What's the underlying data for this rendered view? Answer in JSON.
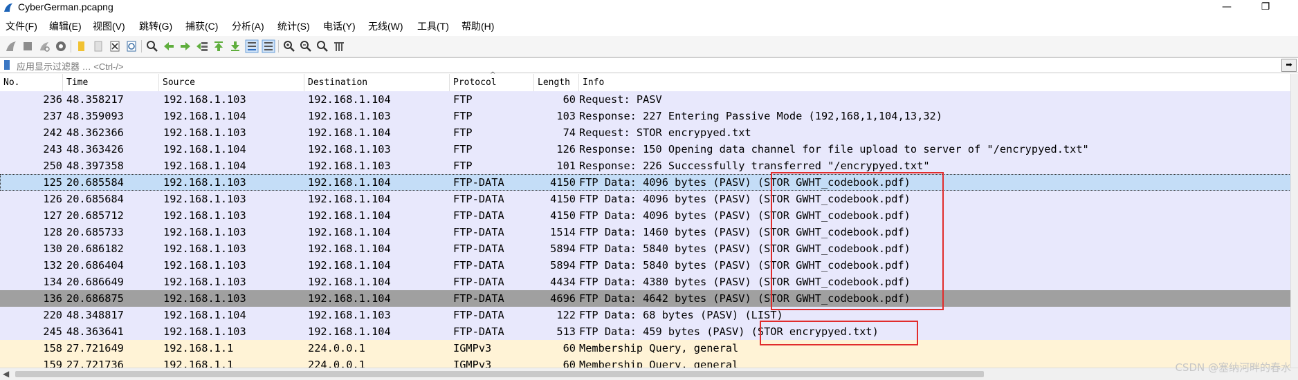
{
  "window": {
    "title": "CyberGerman.pcapng",
    "minimize": "—",
    "maximize": "❐"
  },
  "menu": [
    "文件(F)",
    "编辑(E)",
    "视图(V)",
    "跳转(G)",
    "捕获(C)",
    "分析(A)",
    "统计(S)",
    "电话(Y)",
    "无线(W)",
    "工具(T)",
    "帮助(H)"
  ],
  "filter": {
    "placeholder": "应用显示过滤器 … <Ctrl-/>",
    "apply_icon": "arrow-right-icon"
  },
  "columns": {
    "no": "No.",
    "time": "Time",
    "source": "Source",
    "destination": "Destination",
    "protocol": "Protocol",
    "length": "Length",
    "info": "Info"
  },
  "rows": [
    {
      "no": "236",
      "time": "48.358217",
      "src": "192.168.1.103",
      "dst": "192.168.1.104",
      "proto": "FTP",
      "len": "60",
      "info": "Request: PASV",
      "bg": "#e8e8fc"
    },
    {
      "no": "237",
      "time": "48.359093",
      "src": "192.168.1.104",
      "dst": "192.168.1.103",
      "proto": "FTP",
      "len": "103",
      "info": "Response: 227 Entering Passive Mode (192,168,1,104,13,32)",
      "bg": "#e8e8fc"
    },
    {
      "no": "242",
      "time": "48.362366",
      "src": "192.168.1.103",
      "dst": "192.168.1.104",
      "proto": "FTP",
      "len": "74",
      "info": "Request: STOR encrypyed.txt",
      "bg": "#e8e8fc"
    },
    {
      "no": "243",
      "time": "48.363426",
      "src": "192.168.1.104",
      "dst": "192.168.1.103",
      "proto": "FTP",
      "len": "126",
      "info": "Response: 150 Opening data channel for file upload to server of \"/encrypyed.txt\"",
      "bg": "#e8e8fc"
    },
    {
      "no": "250",
      "time": "48.397358",
      "src": "192.168.1.104",
      "dst": "192.168.1.103",
      "proto": "FTP",
      "len": "101",
      "info": "Response: 226 Successfully transferred \"/encrypyed.txt\"",
      "bg": "#e8e8fc"
    },
    {
      "no": "125",
      "time": "20.685584",
      "src": "192.168.1.103",
      "dst": "192.168.1.104",
      "proto": "FTP-DATA",
      "len": "4150",
      "info": "FTP Data: 4096 bytes (PASV) (STOR GWHT_codebook.pdf)",
      "bg": "#c4ddf7",
      "selected": true
    },
    {
      "no": "126",
      "time": "20.685684",
      "src": "192.168.1.103",
      "dst": "192.168.1.104",
      "proto": "FTP-DATA",
      "len": "4150",
      "info": "FTP Data: 4096 bytes (PASV) (STOR GWHT_codebook.pdf)",
      "bg": "#e8e8fc"
    },
    {
      "no": "127",
      "time": "20.685712",
      "src": "192.168.1.103",
      "dst": "192.168.1.104",
      "proto": "FTP-DATA",
      "len": "4150",
      "info": "FTP Data: 4096 bytes (PASV) (STOR GWHT_codebook.pdf)",
      "bg": "#e8e8fc"
    },
    {
      "no": "128",
      "time": "20.685733",
      "src": "192.168.1.103",
      "dst": "192.168.1.104",
      "proto": "FTP-DATA",
      "len": "1514",
      "info": "FTP Data: 1460 bytes (PASV) (STOR GWHT_codebook.pdf)",
      "bg": "#e8e8fc"
    },
    {
      "no": "130",
      "time": "20.686182",
      "src": "192.168.1.103",
      "dst": "192.168.1.104",
      "proto": "FTP-DATA",
      "len": "5894",
      "info": "FTP Data: 5840 bytes (PASV) (STOR GWHT_codebook.pdf)",
      "bg": "#e8e8fc"
    },
    {
      "no": "132",
      "time": "20.686404",
      "src": "192.168.1.103",
      "dst": "192.168.1.104",
      "proto": "FTP-DATA",
      "len": "5894",
      "info": "FTP Data: 5840 bytes (PASV) (STOR GWHT_codebook.pdf)",
      "bg": "#e8e8fc"
    },
    {
      "no": "134",
      "time": "20.686649",
      "src": "192.168.1.103",
      "dst": "192.168.1.104",
      "proto": "FTP-DATA",
      "len": "4434",
      "info": "FTP Data: 4380 bytes (PASV) (STOR GWHT_codebook.pdf)",
      "bg": "#e8e8fc"
    },
    {
      "no": "136",
      "time": "20.686875",
      "src": "192.168.1.103",
      "dst": "192.168.1.104",
      "proto": "FTP-DATA",
      "len": "4696",
      "info": "FTP Data: 4642 bytes (PASV) (STOR GWHT_codebook.pdf)",
      "bg": "#a0a0a0"
    },
    {
      "no": "220",
      "time": "48.348817",
      "src": "192.168.1.104",
      "dst": "192.168.1.103",
      "proto": "FTP-DATA",
      "len": "122",
      "info": "FTP Data: 68 bytes (PASV) (LIST)",
      "bg": "#e8e8fc"
    },
    {
      "no": "245",
      "time": "48.363641",
      "src": "192.168.1.103",
      "dst": "192.168.1.104",
      "proto": "FTP-DATA",
      "len": "513",
      "info": "FTP Data: 459 bytes (PASV) (STOR encrypyed.txt)",
      "bg": "#e8e8fc"
    },
    {
      "no": "158",
      "time": "27.721649",
      "src": "192.168.1.1",
      "dst": "224.0.0.1",
      "proto": "IGMPv3",
      "len": "60",
      "info": "Membership Query, general",
      "bg": "#fff3d6"
    },
    {
      "no": "159",
      "time": "27.721736",
      "src": "192.168.1.1",
      "dst": "224.0.0.1",
      "proto": "IGMPv3",
      "len": "60",
      "info": "Membership Query, general",
      "bg": "#fff3d6"
    }
  ],
  "toolbar_icons": [
    "shark-fin-start-icon",
    "stop-icon",
    "restart-icon",
    "options-gear-icon",
    "open-folder-icon",
    "file-icon",
    "close-file-icon",
    "reload-icon",
    "find-icon",
    "back-arrow-icon",
    "forward-arrow-icon",
    "go-to-packet-icon",
    "first-packet-icon",
    "last-packet-icon",
    "autoscroll-icon",
    "colorize-icon",
    "zoom-in-icon",
    "zoom-out-icon",
    "zoom-normal-icon",
    "resize-columns-icon"
  ],
  "watermark": "CSDN @塞纳河畔的春水",
  "colors": {
    "highlight_box": "#e12c2c",
    "ftp_row": "#e8e8fc",
    "igmp_row": "#fff3d6",
    "selected_row": "#c4ddf7",
    "marked_row": "#a0a0a0"
  }
}
